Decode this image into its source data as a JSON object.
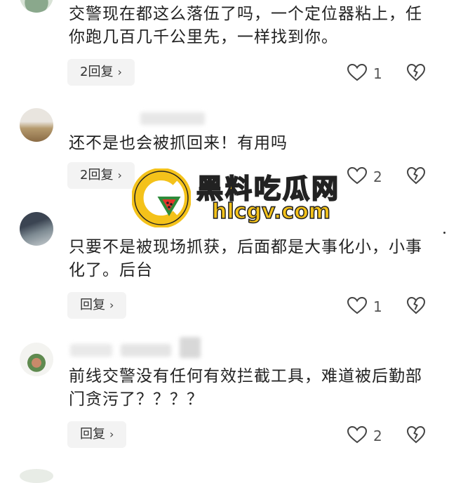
{
  "comments": [
    {
      "text": "交警现在都这么落伍了吗，一个定位器粘上，任你跑几百几千公里先，一样找到你。",
      "reply_label": "2回复",
      "like_count": "1"
    },
    {
      "text": "还不是也会被抓回来！有用吗",
      "reply_label": "2回复",
      "like_count": "2"
    },
    {
      "text": "只要不是被现场抓获，后面都是大事化小，小事化了。后台",
      "reply_label": "回复",
      "like_count": "1"
    },
    {
      "text": "前线交警没有任何有效拦截工具，难道被后勤部门贪污了？？？？",
      "reply_label": "回复",
      "like_count": "2"
    }
  ],
  "watermark": {
    "title": "黑料吃瓜网",
    "url": "hlcgv.com"
  },
  "icons": {
    "chevron": "chevron-right-icon",
    "like": "heart-outline-icon",
    "dislike": "broken-heart-icon"
  },
  "colors": {
    "button_bg": "#f3f3f3",
    "watermark_yellow": "#f4c21a"
  }
}
